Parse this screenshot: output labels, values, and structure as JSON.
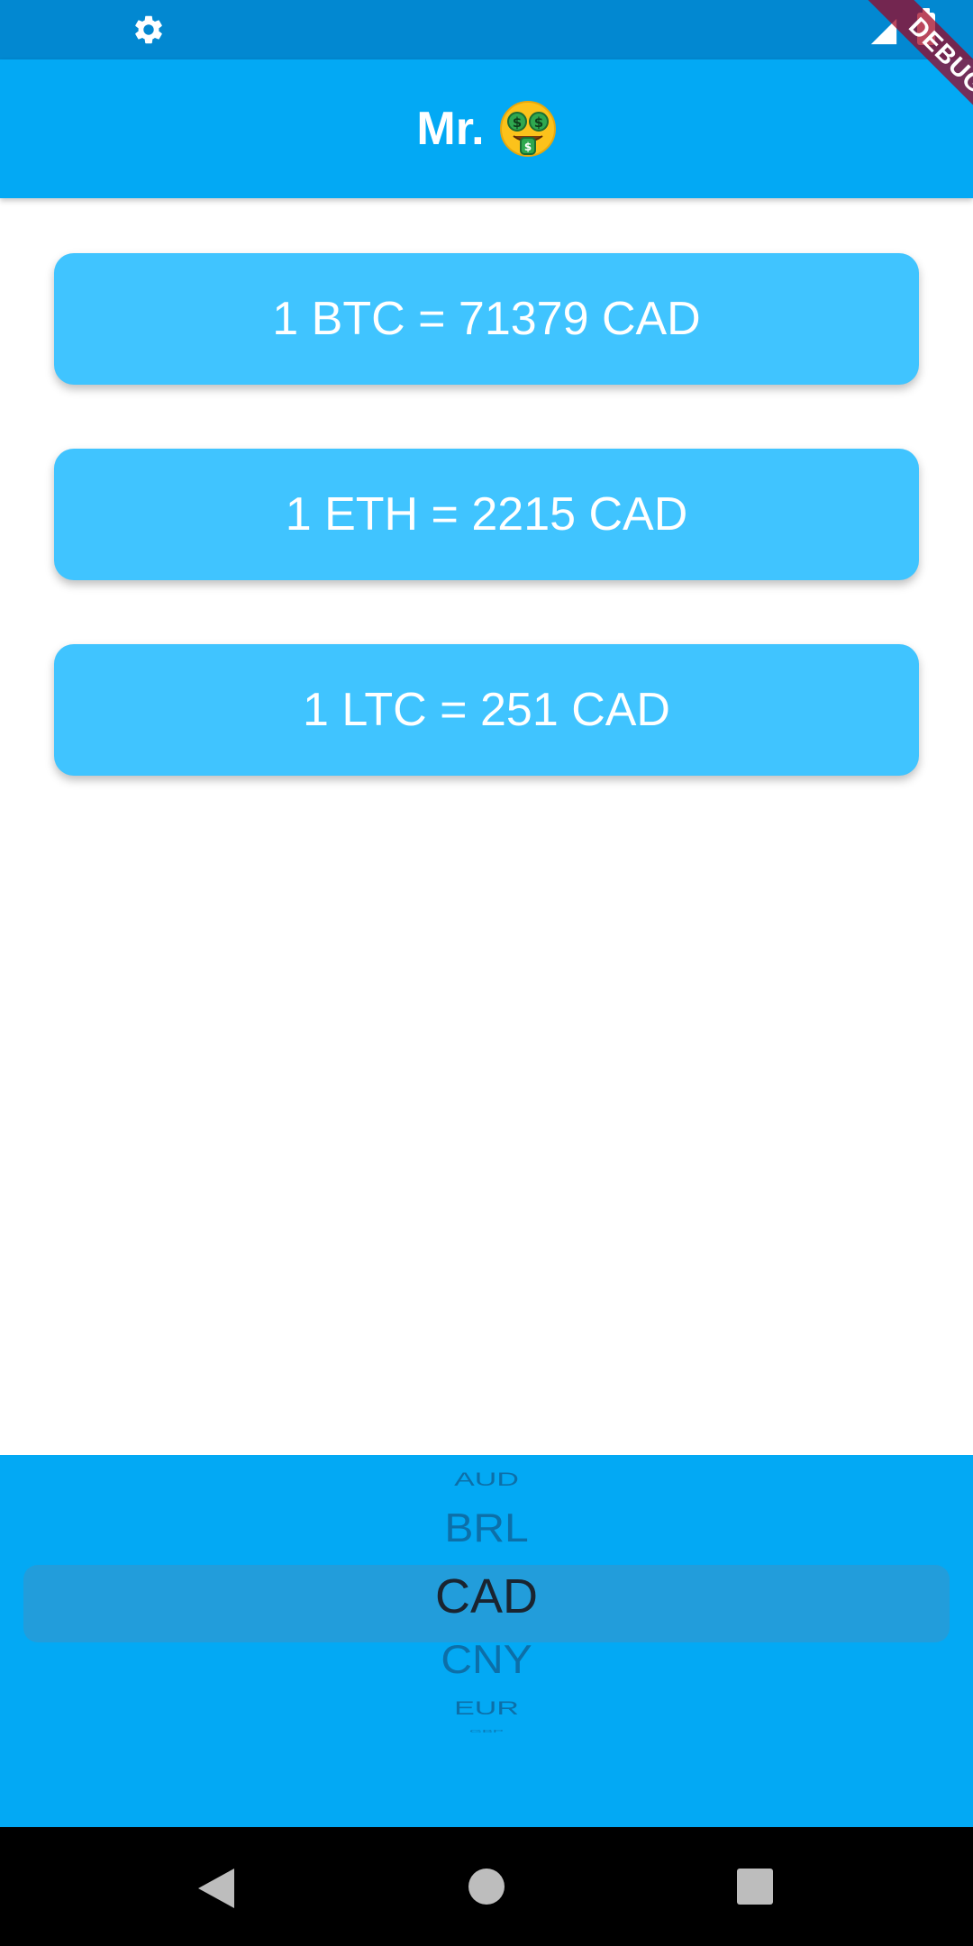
{
  "status_bar": {
    "settings_icon": "gear-icon",
    "signal_icon": "signal-icon",
    "battery_icon": "battery-icon"
  },
  "app_bar": {
    "title": "Mr.",
    "emoji_icon": "money-mouth-face-icon",
    "color": "#03a9f4"
  },
  "debug_banner": {
    "label": "DEBUG"
  },
  "rates": [
    {
      "label": "1 BTC = 71379 CAD"
    },
    {
      "label": "1 ETH = 2215 CAD"
    },
    {
      "label": "1 LTC = 251 CAD"
    }
  ],
  "currency_picker": {
    "items": [
      "AUD",
      "BRL",
      "CAD",
      "CNY",
      "EUR",
      "GBP"
    ],
    "selected": "CAD"
  },
  "navigation": {
    "back_icon": "back-triangle-icon",
    "home_icon": "home-circle-icon",
    "recents_icon": "recents-square-icon"
  },
  "colors": {
    "status_bar": "#0288d1",
    "app_bar": "#03a9f4",
    "card": "#40c4ff",
    "picker_background": "#03a9f4"
  }
}
